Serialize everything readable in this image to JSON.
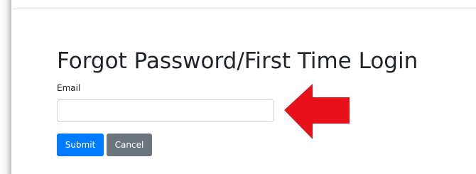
{
  "page": {
    "title": "Forgot Password/First Time Login"
  },
  "form": {
    "email_label": "Email",
    "email_value": "",
    "email_placeholder": ""
  },
  "buttons": {
    "submit_label": "Submit",
    "cancel_label": "Cancel"
  },
  "colors": {
    "primary": "#007bff",
    "secondary": "#6c757d",
    "annotation_arrow": "#e8101b",
    "text": "#212529"
  },
  "annotation": {
    "icon": "red-arrow-left-icon"
  }
}
